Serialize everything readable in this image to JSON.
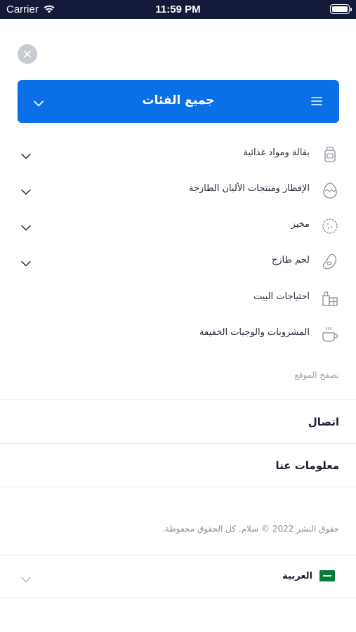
{
  "status_bar": {
    "carrier": "Carrier",
    "time": "11:59 PM"
  },
  "header": {
    "title": "جميع الفئات"
  },
  "categories": [
    {
      "label": "بقالة ومواد غذائية",
      "icon": "grocery-jar-icon",
      "expandable": true
    },
    {
      "label": "الإفطار ومنتجات الألبان الطازجة",
      "icon": "egg-icon",
      "expandable": true
    },
    {
      "label": "مخبز",
      "icon": "bakery-cookie-icon",
      "expandable": true
    },
    {
      "label": "لحم طازج",
      "icon": "meat-icon",
      "expandable": true
    },
    {
      "label": "احتياجات البيت",
      "icon": "household-icon",
      "expandable": false
    },
    {
      "label": "المشروبات والوجبات الخفيفة",
      "icon": "cup-icon",
      "expandable": false
    }
  ],
  "browse": {
    "label": "تصفح الموقع"
  },
  "nav_links": {
    "contact": "اتصال",
    "about": "معلومات عنا"
  },
  "footer": {
    "copyright": "حقوق النشر 2022 © سلام. كل الحقوق محفوظة."
  },
  "language": {
    "label": "العربية"
  },
  "colors": {
    "accent": "#0b6fe8",
    "status_bar": "#141a3a",
    "divider": "#e6e7eb"
  }
}
